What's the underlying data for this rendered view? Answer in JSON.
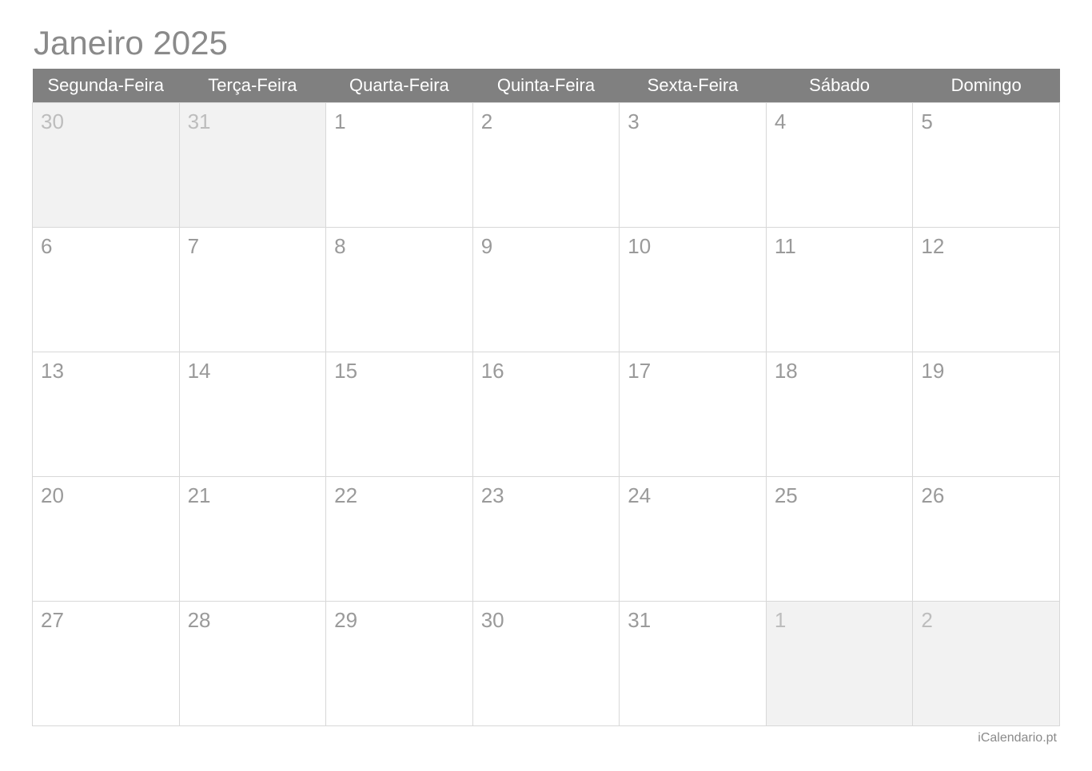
{
  "title": "Janeiro 2025",
  "headers": [
    "Segunda-Feira",
    "Terça-Feira",
    "Quarta-Feira",
    "Quinta-Feira",
    "Sexta-Feira",
    "Sábado",
    "Domingo"
  ],
  "weeks": [
    [
      {
        "day": "30",
        "otherMonth": true
      },
      {
        "day": "31",
        "otherMonth": true
      },
      {
        "day": "1",
        "otherMonth": false
      },
      {
        "day": "2",
        "otherMonth": false
      },
      {
        "day": "3",
        "otherMonth": false
      },
      {
        "day": "4",
        "otherMonth": false
      },
      {
        "day": "5",
        "otherMonth": false
      }
    ],
    [
      {
        "day": "6",
        "otherMonth": false
      },
      {
        "day": "7",
        "otherMonth": false
      },
      {
        "day": "8",
        "otherMonth": false
      },
      {
        "day": "9",
        "otherMonth": false
      },
      {
        "day": "10",
        "otherMonth": false
      },
      {
        "day": "11",
        "otherMonth": false
      },
      {
        "day": "12",
        "otherMonth": false
      }
    ],
    [
      {
        "day": "13",
        "otherMonth": false
      },
      {
        "day": "14",
        "otherMonth": false
      },
      {
        "day": "15",
        "otherMonth": false
      },
      {
        "day": "16",
        "otherMonth": false
      },
      {
        "day": "17",
        "otherMonth": false
      },
      {
        "day": "18",
        "otherMonth": false
      },
      {
        "day": "19",
        "otherMonth": false
      }
    ],
    [
      {
        "day": "20",
        "otherMonth": false
      },
      {
        "day": "21",
        "otherMonth": false
      },
      {
        "day": "22",
        "otherMonth": false
      },
      {
        "day": "23",
        "otherMonth": false
      },
      {
        "day": "24",
        "otherMonth": false
      },
      {
        "day": "25",
        "otherMonth": false
      },
      {
        "day": "26",
        "otherMonth": false
      }
    ],
    [
      {
        "day": "27",
        "otherMonth": false
      },
      {
        "day": "28",
        "otherMonth": false
      },
      {
        "day": "29",
        "otherMonth": false
      },
      {
        "day": "30",
        "otherMonth": false
      },
      {
        "day": "31",
        "otherMonth": false
      },
      {
        "day": "1",
        "otherMonth": true
      },
      {
        "day": "2",
        "otherMonth": true
      }
    ]
  ],
  "footer": "iCalendario.pt"
}
